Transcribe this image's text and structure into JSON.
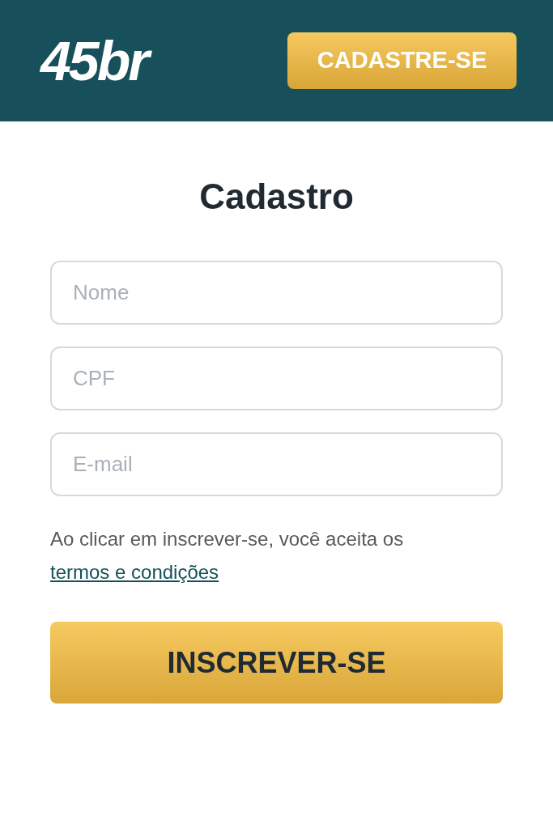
{
  "header": {
    "logo": "45br",
    "signup_button": "CADASTRE-SE"
  },
  "title": "Cadastro",
  "fields": [
    {
      "placeholder": "Nome"
    },
    {
      "placeholder": "CPF"
    },
    {
      "placeholder": "E-mail"
    }
  ],
  "consent": {
    "text": "Ao clicar em inscrever-se, você aceita os",
    "link": "termos e condições"
  },
  "submit_button": "INSCREVER-SE"
}
